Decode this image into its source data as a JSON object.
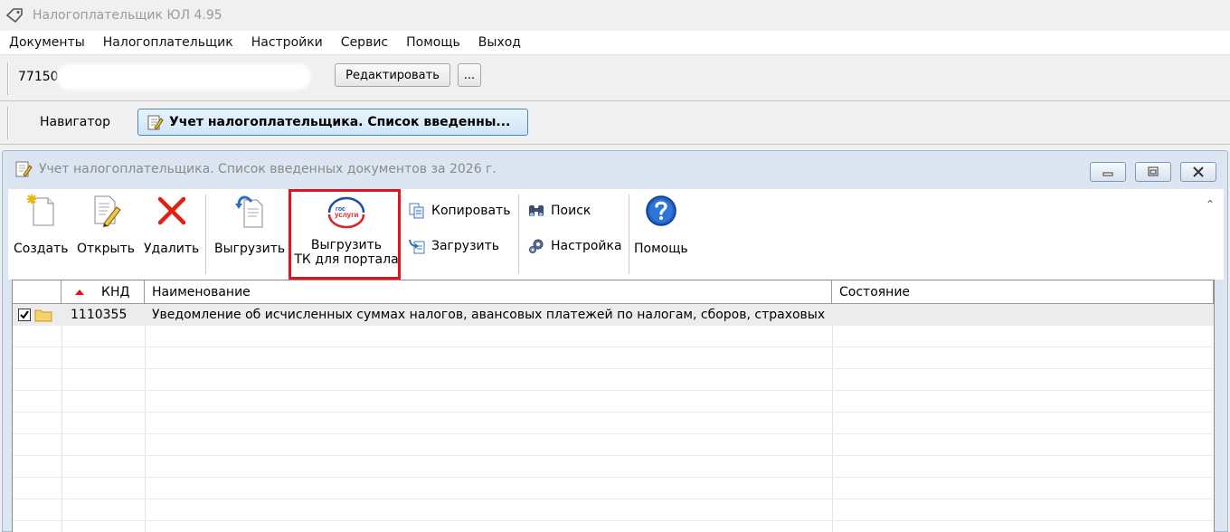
{
  "window": {
    "title": "Налогоплательщик ЮЛ 4.95"
  },
  "menu": [
    "Документы",
    "Налогоплательщик",
    "Настройки",
    "Сервис",
    "Помощь",
    "Выход"
  ],
  "taxpayer": {
    "inn_visible": "77150",
    "edit_label": "Редактировать",
    "more_label": "..."
  },
  "navigator": {
    "label": "Навигатор",
    "active_tab": "Учет налогоплательщика. Список введенны..."
  },
  "child_window": {
    "title": "Учет налогоплательщика. Список введенных документов за 2026 г."
  },
  "toolbar": {
    "create": "Создать",
    "open": "Открыть",
    "delete": "Удалить",
    "export": "Выгрузить",
    "export_tk_line1": "Выгрузить",
    "export_tk_line2": "ТК для портала",
    "gosuslugi_logo_top": "гос",
    "gosuslugi_logo_bottom": "услуги",
    "copy": "Копировать",
    "import": "Загрузить",
    "search": "Поиск",
    "settings": "Настройка",
    "help": "Помощь"
  },
  "grid": {
    "columns": [
      "КНД",
      "Наименование",
      "Состояние"
    ],
    "rows": [
      {
        "knd": "1110355",
        "name": "Уведомление об исчисленных суммах налогов, авансовых платежей по налогам, сборов, страховых ...",
        "status": ""
      }
    ]
  }
}
